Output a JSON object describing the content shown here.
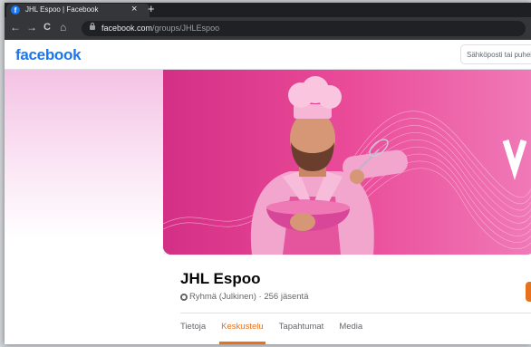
{
  "browser": {
    "tab_title": "JHL Espoo | Facebook",
    "tab_favicon": "f",
    "close_icon": "×",
    "new_tab_icon": "+",
    "url_domain": "facebook.com",
    "url_path": "/groups/JHLEspoo",
    "back_icon": "←",
    "forward_icon": "→",
    "reload_icon": "C",
    "home_icon": "⌂"
  },
  "header": {
    "logo": "facebook",
    "email_placeholder": "Sähköposti tai puhelin"
  },
  "group": {
    "name": "JHL Espoo",
    "meta": "Ryhmä (Julkinen) · 256 jäsentä",
    "tabs": [
      {
        "label": "Tietoja",
        "active": false
      },
      {
        "label": "Keskustelu",
        "active": true
      },
      {
        "label": "Tapahtumat",
        "active": false
      },
      {
        "label": "Media",
        "active": false
      }
    ]
  },
  "colors": {
    "brand": "#1877f2",
    "accent": "#e9711c",
    "cover_pink": "#e3408f"
  }
}
